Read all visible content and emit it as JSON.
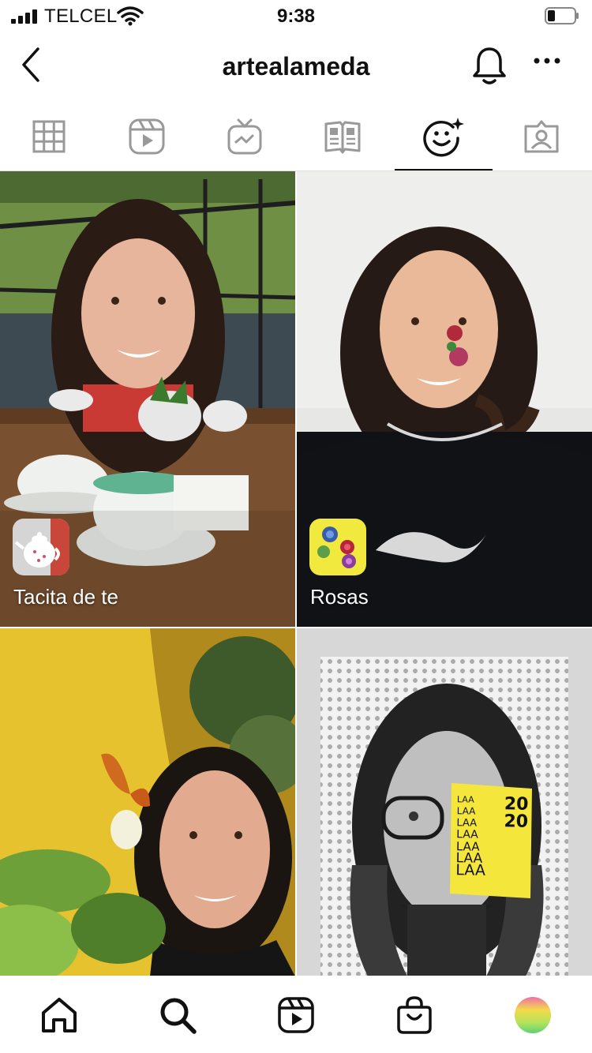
{
  "status_bar": {
    "carrier": "TELCEL",
    "time": "9:38"
  },
  "header": {
    "username": "artealameda"
  },
  "tabs": [
    {
      "name": "grid",
      "icon": "grid-icon"
    },
    {
      "name": "reels",
      "icon": "reels-icon"
    },
    {
      "name": "igtv",
      "icon": "igtv-icon"
    },
    {
      "name": "guides",
      "icon": "guides-icon"
    },
    {
      "name": "effects",
      "icon": "face-sparkle-icon",
      "selected": true
    },
    {
      "name": "tagged",
      "icon": "tagged-icon"
    }
  ],
  "effects": [
    {
      "label": "Tacita de te",
      "icon": "teapot-icon"
    },
    {
      "label": "Rosas",
      "icon": "roses-icon"
    },
    {
      "label": "",
      "icon": ""
    },
    {
      "label": "",
      "icon": ""
    }
  ],
  "sticker": {
    "year_top": "20",
    "year_bottom": "20",
    "lines": [
      "LAA",
      "LAA",
      "LAA",
      "LAA",
      "LAA",
      "LAA",
      "LAA"
    ]
  },
  "colors": {
    "accent": "#111111",
    "sticker_yellow": "#f5e63b",
    "icon_yellow": "#f2e93e",
    "wall_yellow": "#e6c22f"
  },
  "bottom_nav": [
    {
      "name": "home",
      "icon": "home-icon"
    },
    {
      "name": "search",
      "icon": "search-icon"
    },
    {
      "name": "reels",
      "icon": "reels-icon"
    },
    {
      "name": "shop",
      "icon": "shop-icon"
    },
    {
      "name": "profile",
      "icon": "avatar"
    }
  ]
}
